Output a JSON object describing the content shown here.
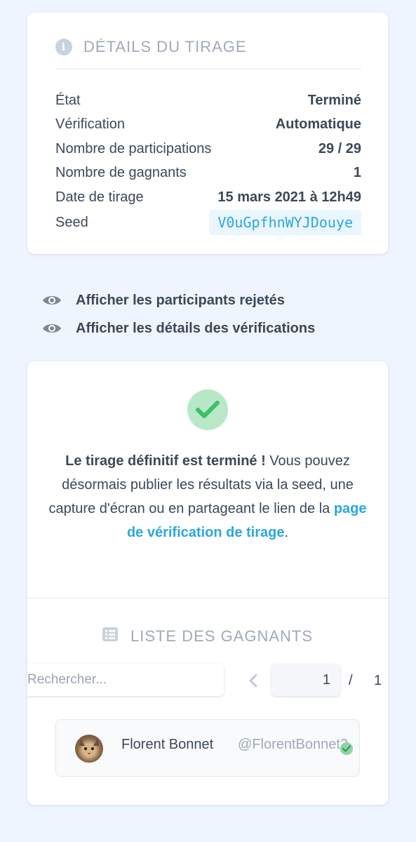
{
  "details": {
    "title": "DÉTAILS DU TIRAGE",
    "rows": [
      {
        "label": "État",
        "value": "Terminé"
      },
      {
        "label": "Vérification",
        "value": "Automatique"
      },
      {
        "label": "Nombre de participations",
        "value": "29 / 29"
      },
      {
        "label": "Nombre de gagnants",
        "value": "1"
      },
      {
        "label": "Date de tirage",
        "value": "15 mars 2021 à 12h49"
      },
      {
        "label": "Seed",
        "value": "V0uGpfhnWYJDouye"
      }
    ]
  },
  "toggles": {
    "rejected": "Afficher les participants rejetés",
    "verifications": "Afficher les détails des vérifications"
  },
  "result": {
    "message_bold": "Le tirage définitif est terminé !",
    "message_text": " Vous pouvez désormais publier les résultats via la seed, une capture d'écran ou en partageant le lien de la ",
    "message_link": "page de vérification de tirage",
    "message_end": "."
  },
  "winners": {
    "title": "LISTE DES GAGNANTS",
    "search_placeholder": "Rechercher...",
    "page_current": "1",
    "page_separator": "/",
    "page_total": "1",
    "items": [
      {
        "name": "Florent Bonnet",
        "handle": "@FlorentBonnet2"
      }
    ]
  },
  "colors": {
    "accent": "#2aa7e0",
    "success": "#3cc06a",
    "background": "#eef5fe"
  }
}
